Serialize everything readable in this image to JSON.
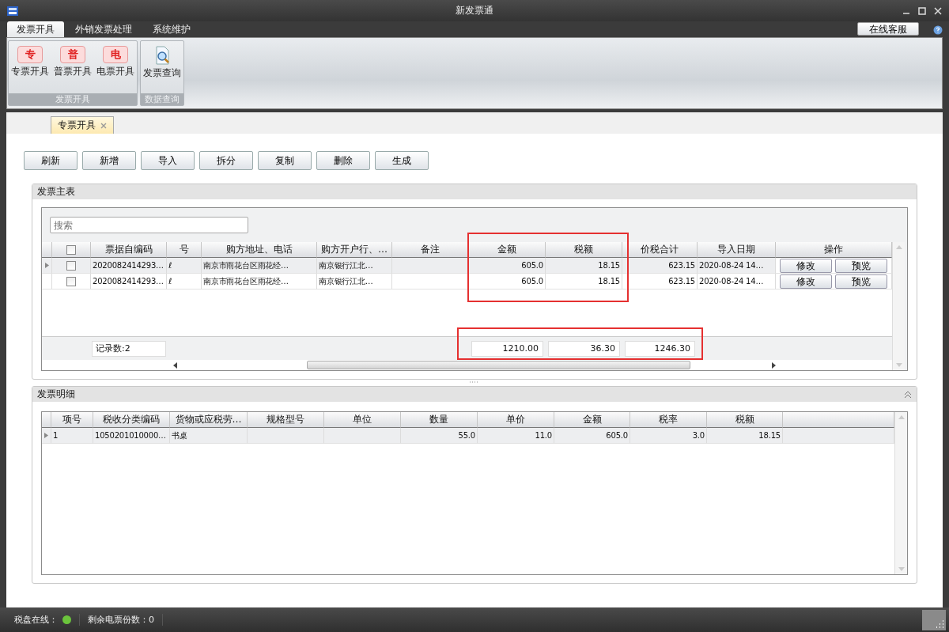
{
  "window": {
    "title": "新发票通"
  },
  "menu_tabs": [
    {
      "label": "发票开具",
      "selected": true
    },
    {
      "label": "外销发票处理",
      "selected": false
    },
    {
      "label": "系统维护",
      "selected": false
    }
  ],
  "service_button": "在线客服",
  "ribbon_groups": [
    {
      "label": "发票开具",
      "items": [
        {
          "kind": "ticket",
          "badge": "专",
          "label": "专票开具"
        },
        {
          "kind": "ticket",
          "badge": "普",
          "label": "普票开具"
        },
        {
          "kind": "ticket",
          "badge": "电",
          "label": "电票开具"
        }
      ]
    },
    {
      "label": "数据查询",
      "items": [
        {
          "kind": "search-doc",
          "label": "发票查询"
        }
      ]
    }
  ],
  "doc_tabs": [
    {
      "label": "专票开具",
      "selected": true
    }
  ],
  "toolbar": [
    "刷新",
    "新增",
    "导入",
    "拆分",
    "复制",
    "删除",
    "生成"
  ],
  "master": {
    "title": "发票主表",
    "search": {
      "placeholder": "搜索"
    },
    "header_checkbox": {
      "checked": false
    },
    "columns": [
      {
        "label": "票据自编码",
        "kind": "text",
        "highlighted": false
      },
      {
        "label": "号",
        "kind": "text",
        "highlighted": false
      },
      {
        "label": "购方地址、电话",
        "kind": "text",
        "highlighted": false
      },
      {
        "label": "购方开户行、…",
        "kind": "text",
        "highlighted": false
      },
      {
        "label": "备注",
        "kind": "text",
        "highlighted": false
      },
      {
        "label": "金额",
        "kind": "number",
        "highlighted": true
      },
      {
        "label": "税额",
        "kind": "number",
        "highlighted": true
      },
      {
        "label": "价税合计",
        "kind": "number",
        "highlighted": false
      },
      {
        "label": "导入日期",
        "kind": "text",
        "highlighted": false
      },
      {
        "label": "操作",
        "kind": "actions",
        "highlighted": false
      }
    ],
    "rows": [
      {
        "current": true,
        "checked": false,
        "cells": [
          "2020082414293…",
          "ℓ",
          "南京市雨花台区雨花经…",
          "南京银行江北…",
          null,
          "605.0",
          "18.15",
          "623.15",
          "2020-08-24 14…",
          [
            "修改",
            "预览"
          ]
        ]
      },
      {
        "current": false,
        "checked": false,
        "cells": [
          "2020082414293…",
          "ℓ",
          "南京市雨花台区雨花经…",
          "南京银行江北…",
          null,
          "605.0",
          "18.15",
          "623.15",
          "2020-08-24 14…",
          [
            "修改",
            "预览"
          ]
        ]
      }
    ],
    "record_count": "记录数:2",
    "totals": [
      "1210.00",
      "36.30",
      "1246.30"
    ],
    "totals_highlighted": true
  },
  "detail": {
    "title": "发票明细",
    "columns": [
      {
        "label": "项号",
        "kind": "text"
      },
      {
        "label": "税收分类编码",
        "kind": "text"
      },
      {
        "label": "货物或应税劳…",
        "kind": "text"
      },
      {
        "label": "规格型号",
        "kind": "text"
      },
      {
        "label": "单位",
        "kind": "text"
      },
      {
        "label": "数量",
        "kind": "number"
      },
      {
        "label": "单价",
        "kind": "number"
      },
      {
        "label": "金额",
        "kind": "number"
      },
      {
        "label": "税率",
        "kind": "number"
      },
      {
        "label": "税额",
        "kind": "number"
      }
    ],
    "rows": [
      {
        "current": true,
        "cells": [
          "1",
          "1050201010000…",
          "书桌",
          null,
          null,
          "55.0",
          "11.0",
          "605.0",
          "3.0",
          "18.15"
        ]
      }
    ]
  },
  "status_bar": [
    {
      "label": "税盘在线：",
      "indicator": {
        "on": true
      }
    },
    {
      "label": "剩余电票份数：0"
    }
  ]
}
